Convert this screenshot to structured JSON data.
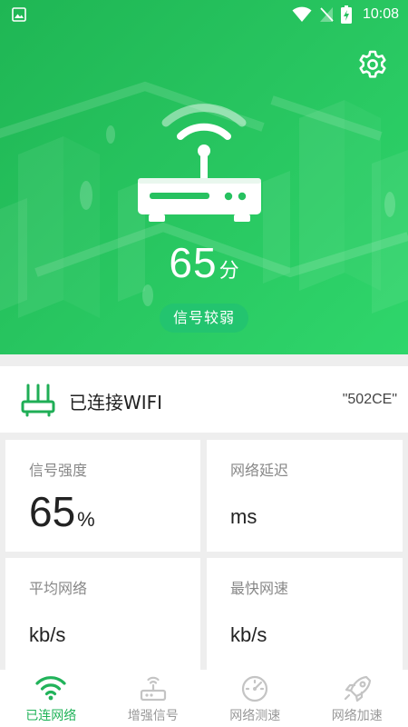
{
  "status_bar": {
    "time": "10:08",
    "icons": [
      "image-icon",
      "wifi-icon",
      "no-signal-icon",
      "battery-charging-icon"
    ]
  },
  "hero": {
    "score_value": "65",
    "score_unit": "分",
    "level_label": "信号较弱",
    "settings_icon": "gear-icon"
  },
  "connection": {
    "label": "已连接WIFI",
    "ssid": "\"502CE\"",
    "icon": "router-antenna-icon"
  },
  "metrics": {
    "signal": {
      "title": "信号强度",
      "value": "65",
      "unit": "%"
    },
    "latency": {
      "title": "网络延迟",
      "value": "",
      "unit": "ms"
    },
    "avg_speed": {
      "title": "平均网络",
      "value": "",
      "unit": "kb/s"
    },
    "max_speed": {
      "title": "最快网速",
      "value": "",
      "unit": "kb/s"
    }
  },
  "nav": {
    "items": [
      {
        "label": "已连网络",
        "icon": "wifi-icon",
        "active": true
      },
      {
        "label": "增强信号",
        "icon": "router-boost-icon",
        "active": false
      },
      {
        "label": "网络测速",
        "icon": "speedometer-icon",
        "active": false
      },
      {
        "label": "网络加速",
        "icon": "rocket-icon",
        "active": false
      }
    ]
  },
  "colors": {
    "brand_green": "#21b35a",
    "hero_gradient_start": "#1fb654",
    "hero_gradient_end": "#2fd66b",
    "pill_green": "#23c46f"
  }
}
